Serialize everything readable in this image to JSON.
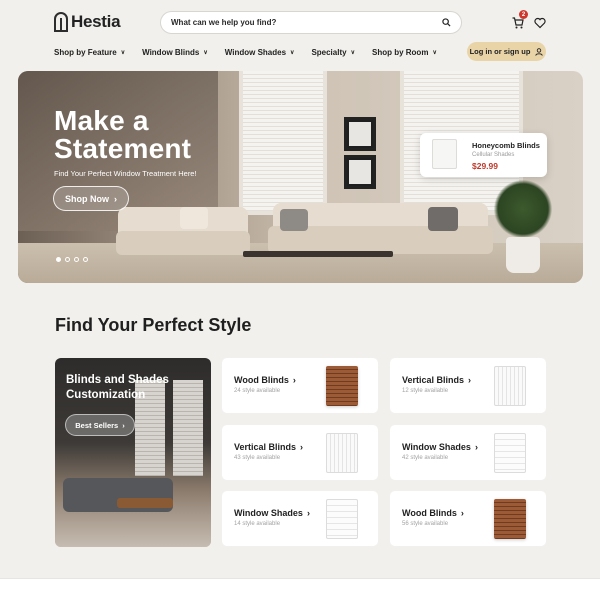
{
  "brand": {
    "name": "Hestia"
  },
  "search": {
    "placeholder": "What can we help you find?"
  },
  "header": {
    "cart_count": "2"
  },
  "nav": {
    "items": [
      {
        "label": "Shop by Feature"
      },
      {
        "label": "Window Blinds"
      },
      {
        "label": "Window Shades"
      },
      {
        "label": "Specialty"
      },
      {
        "label": "Shop by Room"
      }
    ],
    "login_label": "Log in or sign up"
  },
  "hero": {
    "title_line1": "Make a",
    "title_line2": "Statement",
    "subtitle": "Find Your Perfect Window Treatment Here!",
    "cta_label": "Shop Now",
    "slide_count": 4,
    "active_slide": 1,
    "product": {
      "name": "Honeycomb Blinds",
      "category": "Cellular Shades",
      "price": "$29.99"
    }
  },
  "section": {
    "title": "Find Your Perfect Style",
    "feature": {
      "title_line1": "Blinds and Shades",
      "title_line2": "Customization",
      "button_label": "Best Sellers"
    },
    "cards": [
      {
        "title": "Wood Blinds",
        "count": "24 style available",
        "image": "wood-blinds"
      },
      {
        "title": "Vertical Blinds",
        "count": "12 style available",
        "image": "vertical-blinds"
      },
      {
        "title": "Vertical Blinds",
        "count": "43 style available",
        "image": "vertical-blinds"
      },
      {
        "title": "Window Shades",
        "count": "42 style available",
        "image": "window-shades"
      },
      {
        "title": "Window Shades",
        "count": "14 style available",
        "image": "window-shades"
      },
      {
        "title": "Wood Blinds",
        "count": "56 style available",
        "image": "wood-blinds"
      }
    ]
  },
  "colors": {
    "background": "#f1f0ec",
    "accent": "#e9d4a8",
    "price": "#c0392b",
    "badge": "#d0362c"
  }
}
